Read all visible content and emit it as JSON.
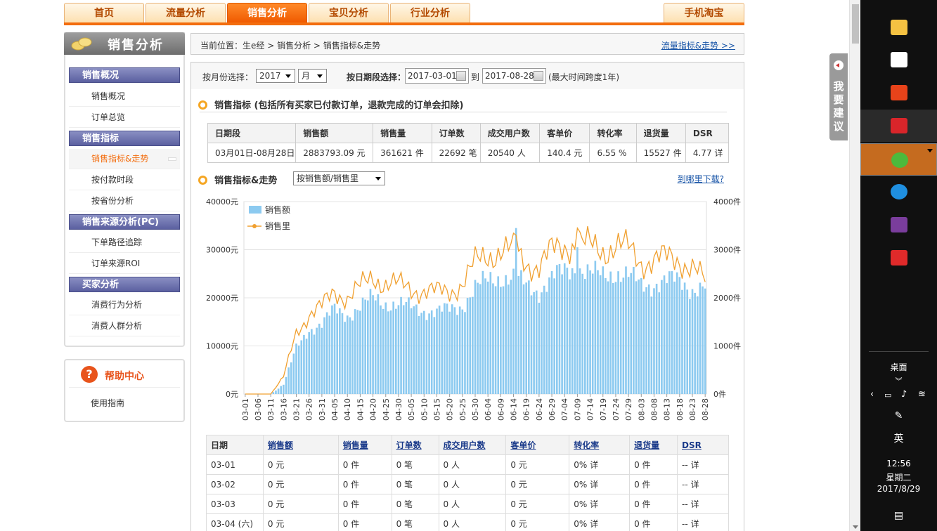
{
  "nav": {
    "tabs": [
      "首页",
      "流量分析",
      "销售分析",
      "宝贝分析",
      "行业分析"
    ],
    "right_tab": "手机淘宝",
    "active": "销售分析"
  },
  "sidebar": {
    "title": "销售分析",
    "groups": [
      {
        "label": "销售概况",
        "items": [
          "销售概况",
          "订单总览"
        ]
      },
      {
        "label": "销售指标",
        "items": [
          "销售指标&走势",
          "按付款时段",
          "按省份分析"
        ]
      },
      {
        "label": "销售来源分析(PC)",
        "items": [
          "下单路径追踪",
          "订单来源ROI"
        ]
      },
      {
        "label": "买家分析",
        "items": [
          "消费行为分析",
          "消费人群分析"
        ]
      }
    ],
    "active_item": "销售指标&走势"
  },
  "help": {
    "title": "帮助中心",
    "icon_char": "?",
    "link": "使用指南"
  },
  "breadcrumb": {
    "text": "当前位置：生e经 > 销售分析 > 销售指标&走势",
    "link": "流量指标&走势 >>"
  },
  "filter": {
    "month_label": "按月份选择：",
    "year": "2017",
    "month": "月",
    "range_label": "按日期段选择：",
    "start": "2017-03-01",
    "to": "到",
    "end": "2017-08-28",
    "note": "(最大时间跨度1年)"
  },
  "summary": {
    "title": "销售指标 (包括所有买家已付款订单，退款完成的订单会扣除)",
    "headers": [
      "日期段",
      "销售额",
      "销售量",
      "订单数",
      "成交用户数",
      "客单价",
      "转化率",
      "退货量",
      "DSR"
    ],
    "row": [
      "03月01日-08月28日",
      "2883793.09 元",
      "361621 件",
      "22692 笔",
      "20540 人",
      "140.4 元",
      "6.55 %",
      "15527 件",
      "4.77 详"
    ]
  },
  "trend": {
    "title": "销售指标&走势",
    "select": "按销售额/销售里",
    "download": "到哪里下载?"
  },
  "chart_data": {
    "type": "bar",
    "title": "",
    "series": [
      {
        "name": "销售额",
        "kind": "bar",
        "axis": "left"
      },
      {
        "name": "销售里",
        "kind": "line",
        "axis": "right"
      }
    ],
    "left_axis": {
      "ticks": [
        "40000元",
        "30000元",
        "20000元",
        "10000元",
        "0元"
      ],
      "ylim": [
        0,
        40000
      ]
    },
    "right_axis": {
      "ticks": [
        "4000件",
        "3000件",
        "2000件",
        "1000件",
        "0件"
      ],
      "ylim": [
        0,
        4000
      ]
    },
    "x_ticks": [
      "03-01",
      "03-06",
      "03-11",
      "03-16",
      "03-21",
      "03-26",
      "03-31",
      "04-05",
      "04-10",
      "04-15",
      "04-20",
      "04-25",
      "04-30",
      "05-05",
      "05-10",
      "05-15",
      "05-20",
      "05-25",
      "05-30",
      "06-04",
      "06-09",
      "06-14",
      "06-19",
      "06-24",
      "06-29",
      "07-04",
      "07-09",
      "07-14",
      "07-19",
      "07-24",
      "07-29",
      "08-03",
      "08-08",
      "08-13",
      "08-18",
      "08-23",
      "08-28"
    ],
    "weekly_sales": [
      0,
      0,
      0,
      2000,
      9500,
      13500,
      14500,
      17500,
      16500,
      18000,
      20000,
      19000,
      18500,
      18000,
      17500,
      17000,
      17500,
      18500,
      22000,
      23500,
      24500,
      24000,
      22500,
      21500,
      24000,
      25500,
      26500,
      25000,
      24500,
      25500,
      24500,
      22500,
      23000,
      23500,
      23500,
      22000,
      22000
    ],
    "weekly_qty": [
      0,
      0,
      0,
      350,
      1300,
      1650,
      1800,
      2150,
      2000,
      2200,
      2450,
      2300,
      2250,
      2200,
      2150,
      2100,
      2150,
      2300,
      2700,
      2900,
      3000,
      2950,
      2750,
      2650,
      2950,
      3100,
      3150,
      3050,
      3000,
      3100,
      3000,
      2750,
      2800,
      2800,
      2800,
      2650,
      2300
    ],
    "legend": "top-left",
    "grid": true
  },
  "detail": {
    "headers": [
      "日期",
      "销售额",
      "销售量",
      "订单数",
      "成交用户数",
      "客单价",
      "转化率",
      "退货量",
      "DSR"
    ],
    "rows": [
      [
        "03-01",
        "0 元",
        "0 件",
        "0 笔",
        "0 人",
        "0 元",
        "0% 详",
        "0 件",
        "-- 详"
      ],
      [
        "03-02",
        "0 元",
        "0 件",
        "0 笔",
        "0 人",
        "0 元",
        "0% 详",
        "0 件",
        "-- 详"
      ],
      [
        "03-03",
        "0 元",
        "0 件",
        "0 笔",
        "0 人",
        "0 元",
        "0% 详",
        "0 件",
        "-- 详"
      ],
      [
        "03-04 (六)",
        "0 元",
        "0 件",
        "0 笔",
        "0 人",
        "0 元",
        "0% 详",
        "0 件",
        "-- 详"
      ]
    ]
  },
  "feedback": {
    "text": "我要建议"
  },
  "taskbar": {
    "icons": [
      {
        "name": "file-explorer-icon",
        "color": "#f5c242"
      },
      {
        "name": "store-icon",
        "color": "#ffffff"
      },
      {
        "name": "taobao-icon",
        "color": "#e8431a"
      },
      {
        "name": "tmall-icon",
        "color": "#d9252a"
      },
      {
        "name": "wechat-icon",
        "color": "#4cb93c"
      },
      {
        "name": "edge-icon",
        "color": "#1f8fe0"
      },
      {
        "name": "winrar-icon",
        "color": "#7a3d9c"
      },
      {
        "name": "xmind-icon",
        "color": "#e02a2a"
      }
    ],
    "desktop": "桌面",
    "ime": "英",
    "time": "12:56",
    "weekday": "星期二",
    "date": "2017/8/29"
  }
}
